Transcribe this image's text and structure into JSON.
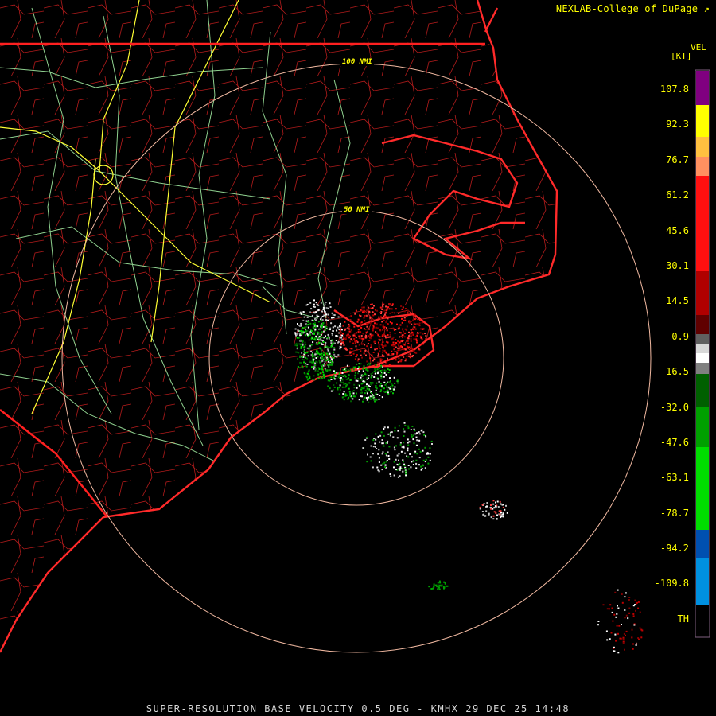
{
  "credit": "NEXLAB-College of DuPage",
  "footer": "SUPER-RESOLUTION BASE VELOCITY 0.5 DEG - KMHX 29 DEC 25 14:48",
  "rings": [
    {
      "label": "100 NMI"
    },
    {
      "label": "50 NMI"
    }
  ],
  "scale": {
    "product": "VEL",
    "unit": "[KT]",
    "labels": [
      "107.8",
      "92.3",
      "76.7",
      "61.2",
      "45.6",
      "30.1",
      "14.5",
      "-0.9",
      "-16.5",
      "-32.0",
      "-47.6",
      "-63.1",
      "-78.7",
      "-94.2",
      "-109.8",
      "TH"
    ]
  },
  "colors": {
    "background": "#000000",
    "state_border": "#ff2020",
    "county_border": "#c81e1e",
    "coastline": "#ff2a2a",
    "highway_primary": "#ffff33",
    "highway_secondary": "#9fe89f",
    "range_ring": "#f0b8a0",
    "label_text": "#ffff00",
    "footer_text": "#d8d8d8"
  },
  "icons": {
    "credit_logo": "nexlab-logo-icon"
  }
}
